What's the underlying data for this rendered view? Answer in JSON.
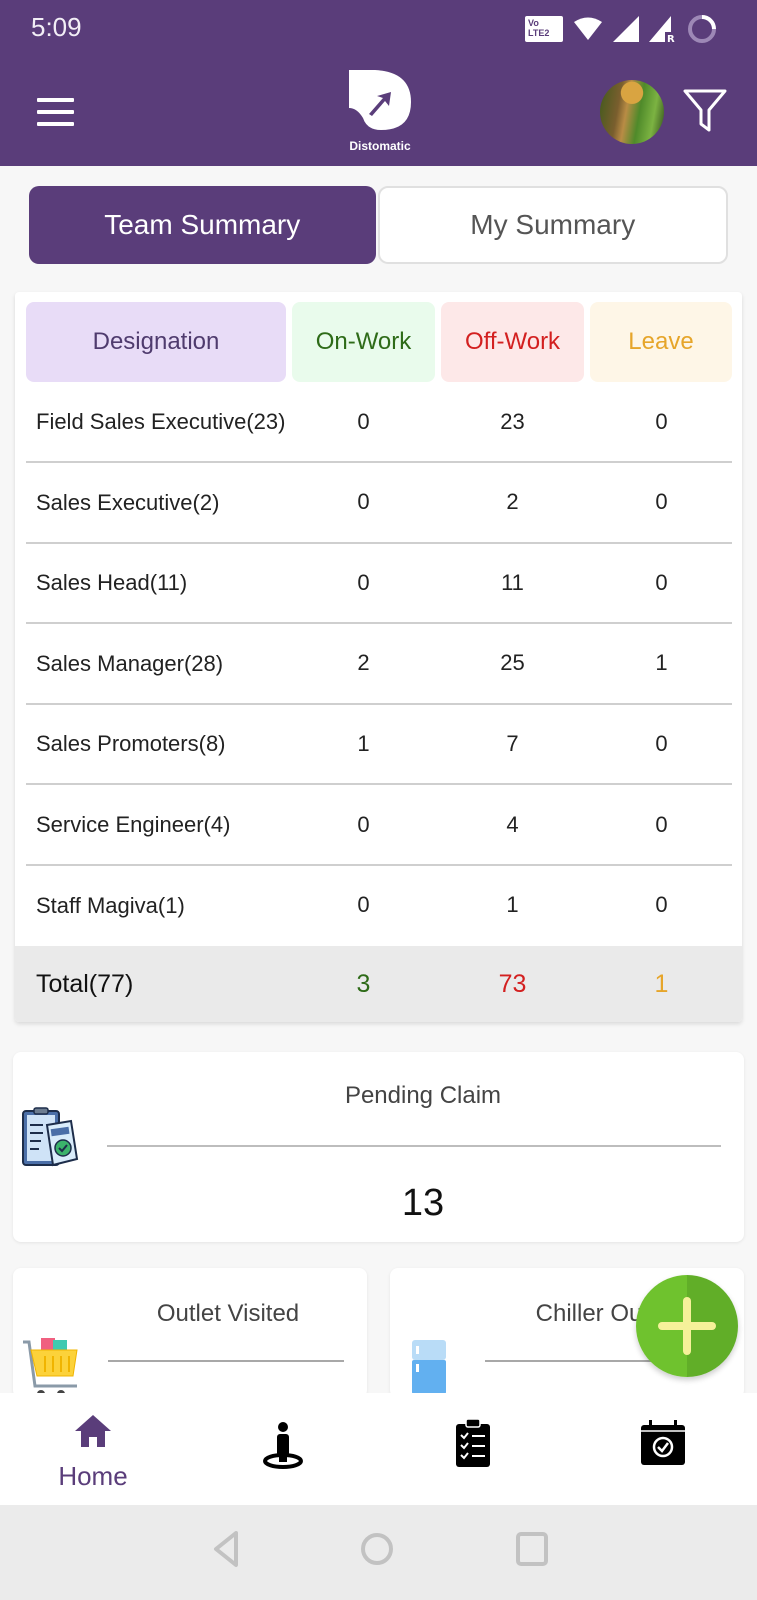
{
  "status_bar": {
    "time": "5:09",
    "volte_label": "Vo LTE 2",
    "icons": [
      "volte-icon",
      "wifi-icon",
      "signal-icon",
      "signal-roaming-icon",
      "battery-ring-icon"
    ]
  },
  "app_bar": {
    "brand": "Distomatic",
    "menu_icon": "hamburger-icon",
    "filter_icon": "filter-icon"
  },
  "tabs": [
    {
      "label": "Team Summary",
      "active": true
    },
    {
      "label": "My Summary",
      "active": false
    }
  ],
  "team_table": {
    "headers": {
      "designation": "Designation",
      "on_work": "On-Work",
      "off_work": "Off-Work",
      "leave": "Leave"
    },
    "rows": [
      {
        "designation": "Field Sales Executive(23)",
        "on_work": "0",
        "off_work": "23",
        "leave": "0"
      },
      {
        "designation": "Sales Executive(2)",
        "on_work": "0",
        "off_work": "2",
        "leave": "0"
      },
      {
        "designation": "Sales Head(11)",
        "on_work": "0",
        "off_work": "11",
        "leave": "0"
      },
      {
        "designation": "Sales Manager(28)",
        "on_work": "2",
        "off_work": "25",
        "leave": "1"
      },
      {
        "designation": "Sales Promoters(8)",
        "on_work": "1",
        "off_work": "7",
        "leave": "0"
      },
      {
        "designation": "Service Engineer(4)",
        "on_work": "0",
        "off_work": "4",
        "leave": "0"
      },
      {
        "designation": "Staff Magiva(1)",
        "on_work": "0",
        "off_work": "1",
        "leave": "0"
      }
    ],
    "total": {
      "label": "Total(77)",
      "on_work": "3",
      "off_work": "73",
      "leave": "1"
    }
  },
  "cards": {
    "pending_claim": {
      "title": "Pending Claim",
      "value": "13",
      "icon": "claim-clipboard-icon"
    },
    "outlet_visited": {
      "title": "Outlet Visited",
      "icon": "shopping-cart-icon"
    },
    "chiller_outlet": {
      "title": "Chiller Outlet",
      "icon": "refrigerator-icon"
    }
  },
  "fab": {
    "icon": "plus-icon"
  },
  "bottom_nav": [
    {
      "label": "Home",
      "icon": "home-icon",
      "active": true
    },
    {
      "label": "",
      "icon": "person-location-icon",
      "active": false
    },
    {
      "label": "",
      "icon": "checklist-clipboard-icon",
      "active": false
    },
    {
      "label": "",
      "icon": "calendar-check-icon",
      "active": false
    }
  ],
  "colors": {
    "brand_purple": "#5a3d7a",
    "on_work": "#2e6b18",
    "off_work": "#d32020",
    "leave": "#e6a52a",
    "fab_green": "#6fc22e"
  }
}
